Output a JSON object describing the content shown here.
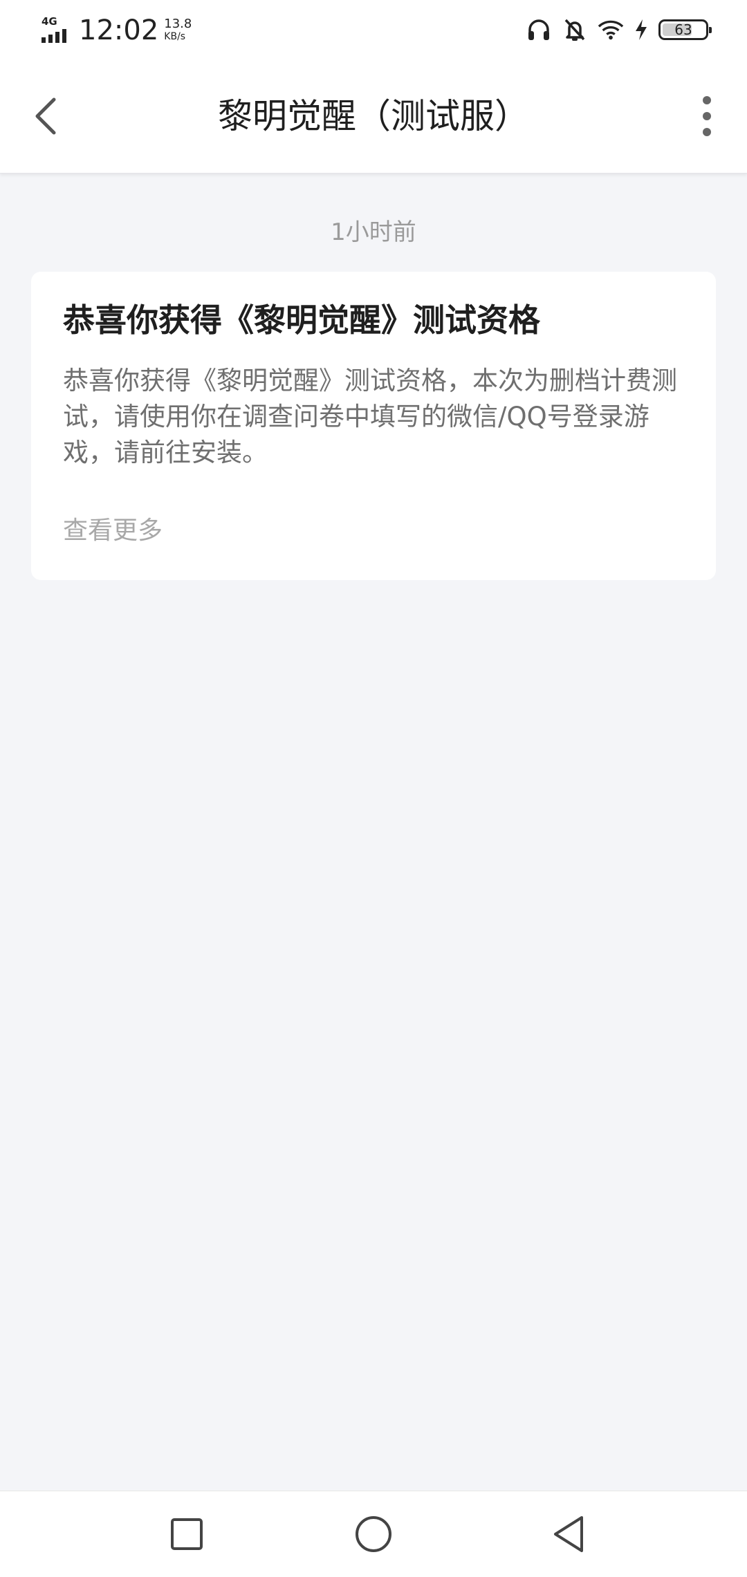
{
  "status_bar": {
    "network": "4G",
    "time": "12:02",
    "speed_value": "13.8",
    "speed_unit": "KB/s",
    "battery_level": "63",
    "icons": [
      "headphones-icon",
      "bell-muted-icon",
      "wifi-icon",
      "charging-icon",
      "battery-icon"
    ]
  },
  "header": {
    "title": "黎明觉醒（测试服）",
    "back_icon": "chevron-left-icon",
    "more_icon": "more-vertical-icon"
  },
  "messages": [
    {
      "timestamp": "1小时前",
      "title": "恭喜你获得《黎明觉醒》测试资格",
      "body": "恭喜你获得《黎明觉醒》测试资格，本次为删档计费测试，请使用你在调查问卷中填写的微信/QQ号登录游戏，请前往安装。",
      "more_label": "查看更多"
    }
  ],
  "nav_bar": {
    "icons": [
      "square-recents-icon",
      "circle-home-icon",
      "triangle-back-icon"
    ]
  }
}
